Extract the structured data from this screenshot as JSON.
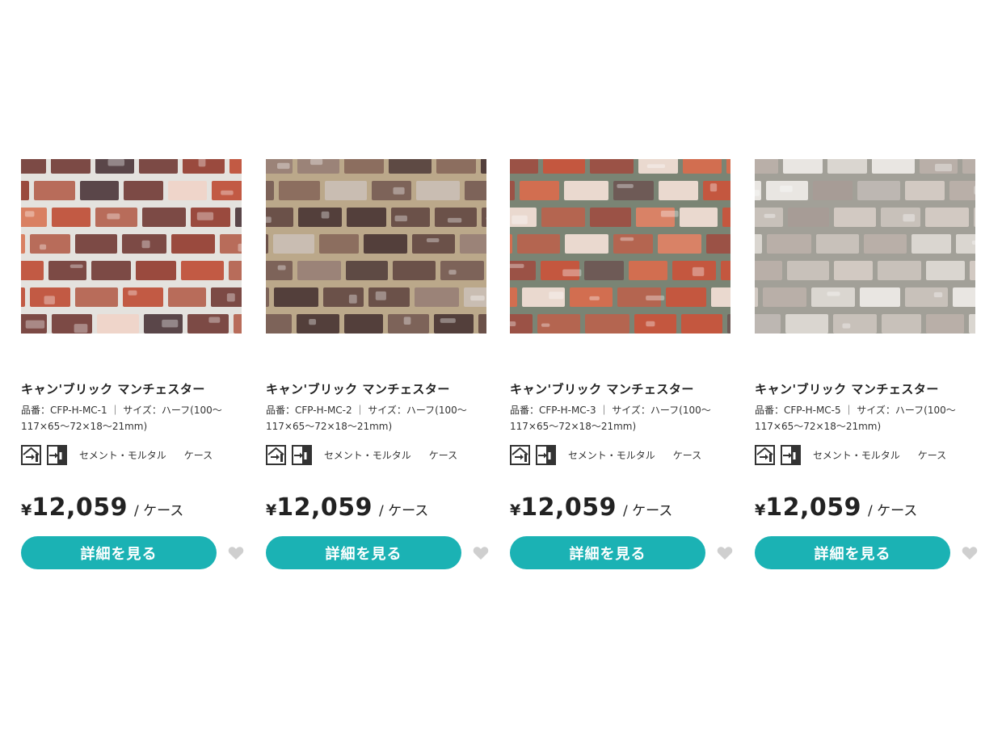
{
  "products": [
    {
      "name": "キャン'ブリック マンチェスター",
      "spec_line1": "品番：CFP-H-MC-1 ｜ サイズ：ハーフ(100〜",
      "spec_line2": "117×65〜72×18〜21mm)",
      "tag1": "セメント・モルタル",
      "tag2": "ケース",
      "currency": "¥",
      "price": "12,059",
      "unit": "/ ケース",
      "button_label": "詳細を見る",
      "icons": [
        "exterior-wall-icon",
        "interior-wall-icon",
        "heart-icon"
      ]
    },
    {
      "name": "キャン'ブリック マンチェスター",
      "spec_line1": "品番：CFP-H-MC-2 ｜ サイズ：ハーフ(100〜",
      "spec_line2": "117×65〜72×18〜21mm)",
      "tag1": "セメント・モルタル",
      "tag2": "ケース",
      "currency": "¥",
      "price": "12,059",
      "unit": "/ ケース",
      "button_label": "詳細を見る",
      "icons": [
        "exterior-wall-icon",
        "interior-wall-icon",
        "heart-icon"
      ]
    },
    {
      "name": "キャン'ブリック マンチェスター",
      "spec_line1": "品番：CFP-H-MC-3 ｜ サイズ：ハーフ(100〜",
      "spec_line2": "117×65〜72×18〜21mm)",
      "tag1": "セメント・モルタル",
      "tag2": "ケース",
      "currency": "¥",
      "price": "12,059",
      "unit": "/ ケース",
      "button_label": "詳細を見る",
      "icons": [
        "exterior-wall-icon",
        "interior-wall-icon",
        "heart-icon"
      ]
    },
    {
      "name": "キャン'ブリック マンチェスター",
      "spec_line1": "品番：CFP-H-MC-5 ｜ サイズ：ハーフ(100〜",
      "spec_line2": "117×65〜72×18〜21mm)",
      "tag1": "セメント・モルタル",
      "tag2": "ケース",
      "currency": "¥",
      "price": "12,059",
      "unit": "/ ケース",
      "button_label": "詳細を見る",
      "icons": [
        "exterior-wall-icon",
        "interior-wall-icon",
        "heart-icon"
      ]
    }
  ],
  "colors": {
    "accent": "#1bb2b4",
    "heart": "#cfcfcf",
    "mortar": [
      "#e4e2de",
      "#bba88a",
      "#7a8474",
      "#a2a098"
    ],
    "bricks": [
      [
        "#c25a44",
        "#9a4a3e",
        "#d98062",
        "#7c4a45",
        "#b86c5a",
        "#efd5ca",
        "#5a4649"
      ],
      [
        "#6b5149",
        "#7d6359",
        "#533f3b",
        "#9b8378",
        "#8c6e5f",
        "#c9bdb2",
        "#5e4a44"
      ],
      [
        "#c4573f",
        "#d26e50",
        "#9b5246",
        "#ead9cf",
        "#6e5a56",
        "#b46550",
        "#d98266"
      ],
      [
        "#dad6d0",
        "#c8c1ba",
        "#b9afa8",
        "#e9e6e2",
        "#a79c96",
        "#d2c9c2",
        "#bdb7b2"
      ]
    ]
  }
}
